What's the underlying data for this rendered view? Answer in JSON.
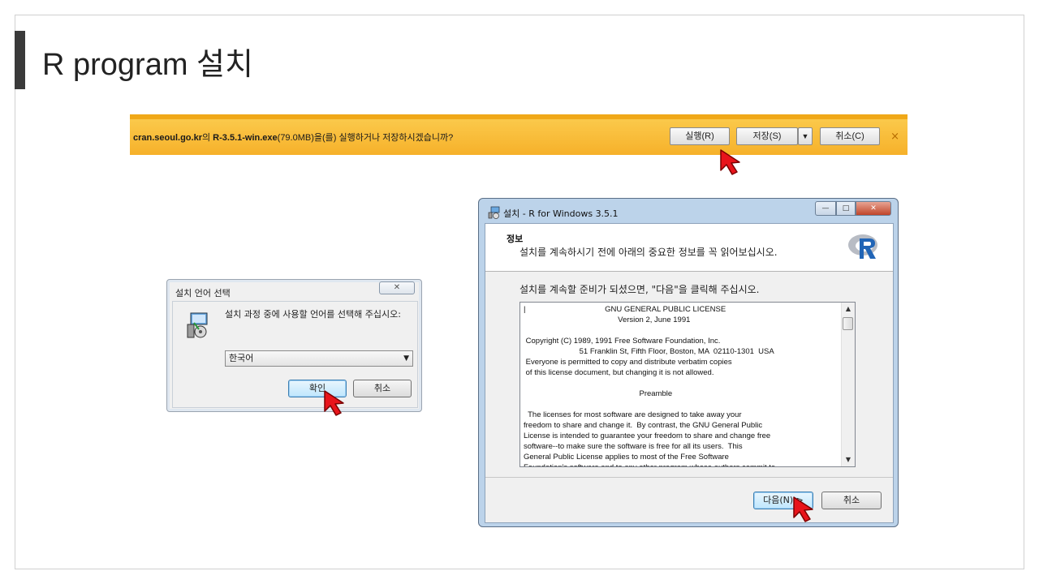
{
  "slide": {
    "title": "R program 설치"
  },
  "download_bar": {
    "site": "cran.seoul.go.kr",
    "particle": "의 ",
    "filename": "R-3.5.1-win.exe",
    "message": "(79.0MB)을(를) 실행하거나 저장하시겠습니까?",
    "run_label": "실행(R)",
    "save_label": "저장(S)",
    "save_dropdown": "▼",
    "cancel_label": "취소(C)",
    "close_glyph": "×"
  },
  "language_dialog": {
    "title": "설치 언어 선택",
    "close_glyph": "✕",
    "message": "설치 과정 중에 사용할 언어를 선택해 주십시오:",
    "selected_language": "한국어",
    "ok_label": "확인",
    "cancel_label": "취소"
  },
  "setup_window": {
    "title": "설치 - R for Windows 3.5.1",
    "minimize_glyph": "—",
    "maximize_glyph": "□",
    "close_glyph": "✕",
    "header_title": "정보",
    "header_subtitle": "설치를 계속하시기 전에 아래의 중요한 정보를 꼭 읽어보십시오.",
    "ready_text": "설치를 계속할 준비가 되셨으면, \"다음\"을 클릭해 주십시오.",
    "license_text": "|                                     GNU GENERAL PUBLIC LICENSE\n                                            Version 2, June 1991\n\n Copyright (C) 1989, 1991 Free Software Foundation, Inc.\n                          51 Franklin St, Fifth Floor, Boston, MA  02110-1301  USA\n Everyone is permitted to copy and distribute verbatim copies\n of this license document, but changing it is not allowed.\n\n                                                      Preamble\n\n  The licenses for most software are designed to take away your\nfreedom to share and change it.  By contrast, the GNU General Public\nLicense is intended to guarantee your freedom to share and change free\nsoftware--to make sure the software is free for all its users.  This\nGeneral Public License applies to most of the Free Software\nFoundation's software and to any other program whose authors commit to",
    "next_label": "다음(N) >",
    "cancel_label": "취소"
  },
  "colors": {
    "download_bar": "#f6b12a",
    "cursor": "#e8141b"
  }
}
